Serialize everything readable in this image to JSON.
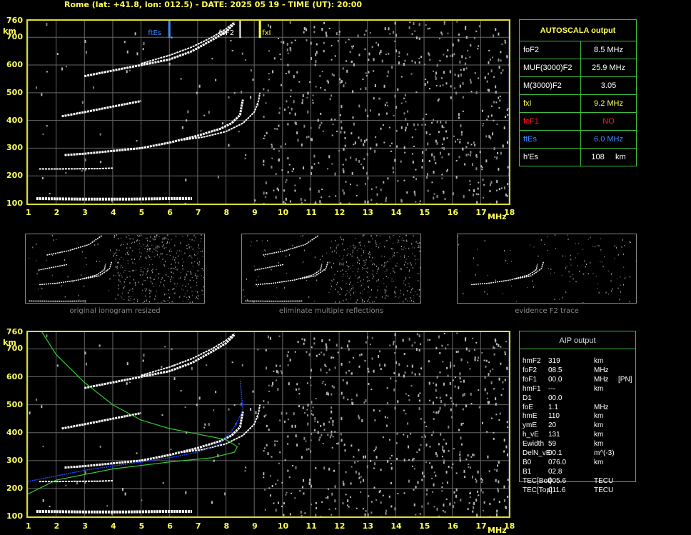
{
  "header": "Rome (lat: +41.8, lon: 012.5) - DATE: 2025 05 19 - TIME (UT): 20:00",
  "axis": {
    "y_unit": "km",
    "x_unit": "MHz",
    "y_ticks": [
      "760",
      "700",
      "600",
      "500",
      "400",
      "300",
      "200",
      "100"
    ],
    "x_ticks": [
      "1",
      "2",
      "3",
      "4",
      "5",
      "6",
      "7",
      "8",
      "9",
      "10",
      "11",
      "12",
      "13",
      "14",
      "15",
      "16",
      "17",
      "18"
    ]
  },
  "markers": {
    "ftEs": "ftEs",
    "foF2": "foF2",
    "fxI": "fxI"
  },
  "autoscala": {
    "title": "AUTOSCALA output",
    "rows": [
      {
        "label": "foF2",
        "value": "8.5 MHz",
        "color": "#ffffff"
      },
      {
        "label": "MUF(3000)F2",
        "value": "25.9 MHz",
        "color": "#ffffff"
      },
      {
        "label": "M(3000)F2",
        "value": "3.05",
        "color": "#ffffff"
      },
      {
        "label": "fxI",
        "value": "9.2 MHz",
        "color": "#ffff55"
      },
      {
        "label": "foF1",
        "value": "NO",
        "color": "#ff2020"
      },
      {
        "label": "ftEs",
        "value": "6.0 MHz",
        "color": "#3a8cff"
      },
      {
        "label": "h'Es",
        "value": "108     km",
        "color": "#ffffff"
      }
    ]
  },
  "thumbnails": {
    "captions": [
      "original ionogram resized",
      "eliminate multiple reflections",
      "evidence F2 trace"
    ]
  },
  "aip": {
    "title": "AIP output",
    "rows": [
      {
        "name": "hmF2",
        "value": "319",
        "unit": "km",
        "extra": ""
      },
      {
        "name": "foF2",
        "value": "08.5",
        "unit": "MHz",
        "extra": ""
      },
      {
        "name": "foF1",
        "value": "00.0",
        "unit": "MHz",
        "extra": "[PN]"
      },
      {
        "name": "hmF1",
        "value": "---",
        "unit": "km",
        "extra": ""
      },
      {
        "name": "D1",
        "value": "00.0",
        "unit": "",
        "extra": ""
      },
      {
        "name": "foE",
        "value": "1.1",
        "unit": "MHz",
        "extra": ""
      },
      {
        "name": "hmE",
        "value": "110",
        "unit": "km",
        "extra": ""
      },
      {
        "name": "ymE",
        "value": "20",
        "unit": "km",
        "extra": ""
      },
      {
        "name": "h_vE",
        "value": "131",
        "unit": "km",
        "extra": ""
      },
      {
        "name": "Ewidth",
        "value": "59",
        "unit": "km",
        "extra": ""
      },
      {
        "name": "DelN_vE",
        "value": "00.1",
        "unit": "m^(-3)",
        "extra": ""
      },
      {
        "name": "B0",
        "value": "076.0",
        "unit": "km",
        "extra": ""
      },
      {
        "name": "B1",
        "value": "02.8",
        "unit": "",
        "extra": ""
      },
      {
        "name": "TEC[Bot]",
        "value": "005.6",
        "unit": "TECU",
        "extra": ""
      },
      {
        "name": "TEC[Top]",
        "value": "011.6",
        "unit": "TECU",
        "extra": ""
      }
    ]
  },
  "colors": {
    "axis": "#dddd33",
    "grid": "#777777",
    "trace": "#ffffff",
    "ftEs": "#3a8cff",
    "fxI": "#ffff33",
    "profile_green": "#33cc33",
    "profile_blue": "#2244ff"
  }
}
